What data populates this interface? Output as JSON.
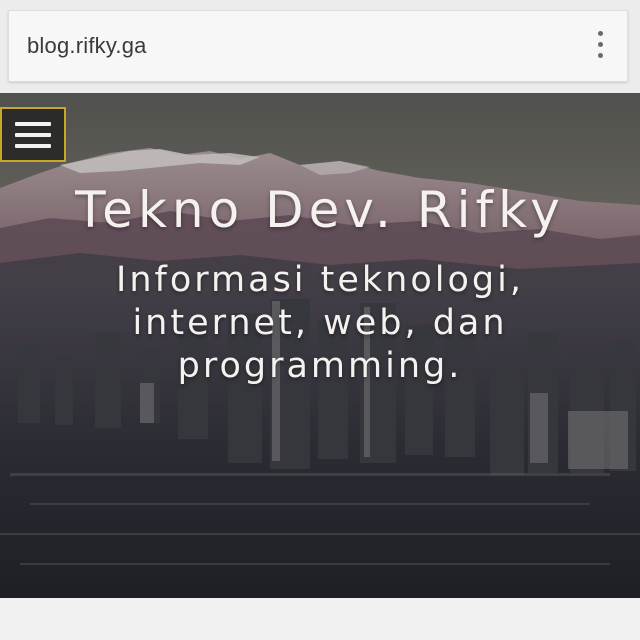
{
  "browser": {
    "url": "blog.rifky.ga",
    "menu_icon": "more-vert-icon"
  },
  "nav": {
    "menu_icon": "hamburger-menu-icon",
    "menu_border_color": "#c9a52a"
  },
  "hero": {
    "title": "Tekno Dev. Rifky",
    "tagline": "Informasi teknologi, internet, web, dan programming.",
    "text_color": "#f4f1ee",
    "background": "mountains-and-city-skyline-photo"
  }
}
